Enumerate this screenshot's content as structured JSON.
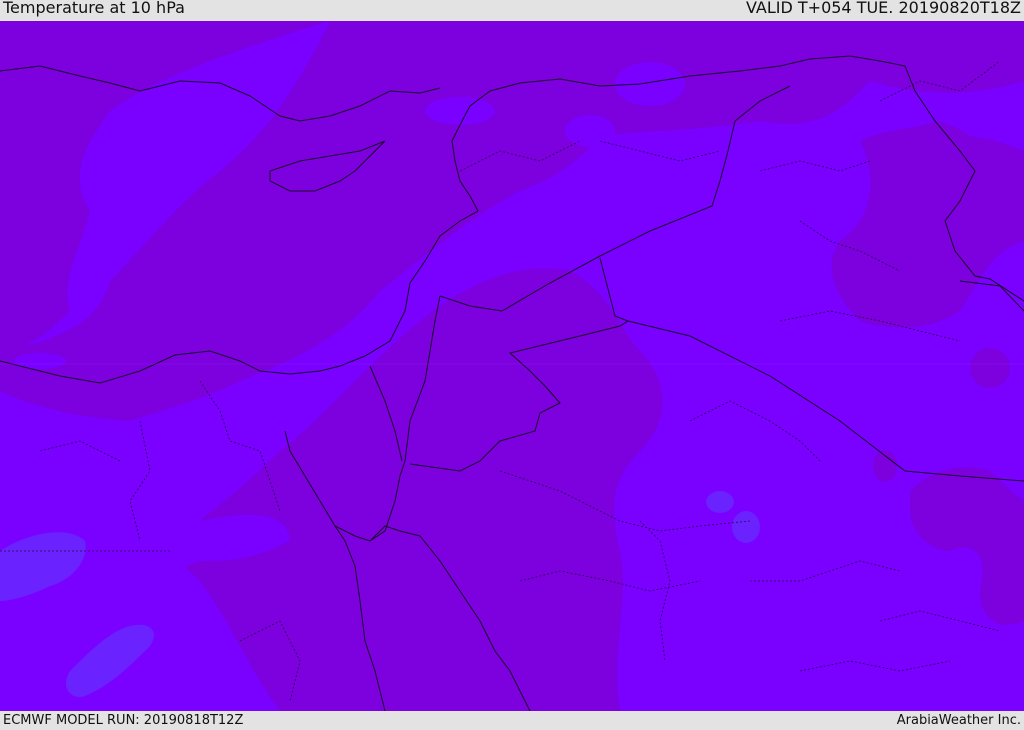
{
  "header": {
    "title": "Temperature at 10 hPa",
    "valid": "VALID T+054 TUE. 20190820T18Z"
  },
  "footer": {
    "model_run": "ECMWF MODEL RUN: 20190818T12Z",
    "brand": "ArabiaWeather Inc."
  },
  "colors": {
    "field_warm": "#7a00ff",
    "field_cool": "#7d00de",
    "field_cold": "#6a22ff",
    "coast": "#1a0a2a",
    "border": "#2a0a4a"
  }
}
